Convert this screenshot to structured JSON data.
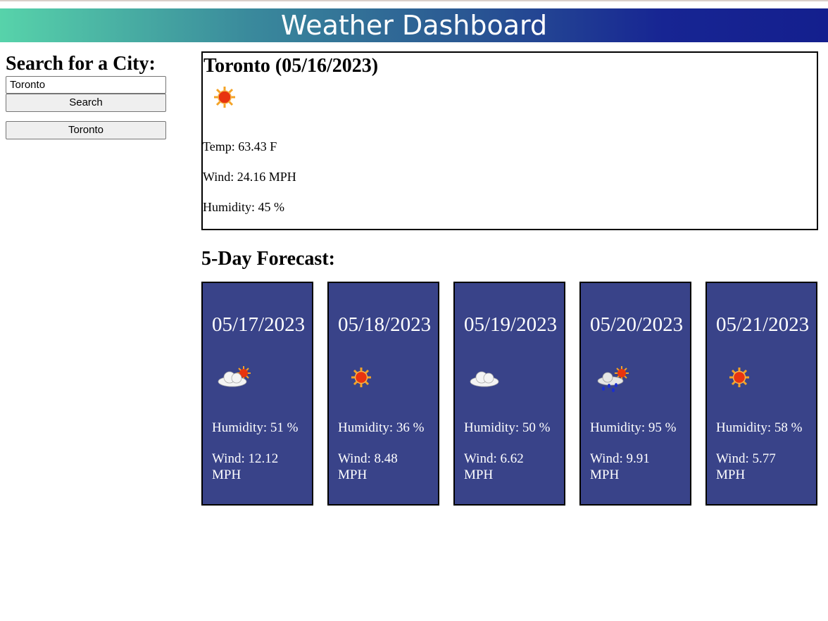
{
  "header": {
    "title": "Weather Dashboard"
  },
  "sidebar": {
    "heading": "Search for a City:",
    "search_value": "Toronto",
    "search_button": "Search",
    "history": [
      "Toronto"
    ]
  },
  "current": {
    "title": "Toronto (05/16/2023)",
    "icon": "sun-icon",
    "temp": "Temp: 63.43 F",
    "wind": "Wind: 24.16 MPH",
    "humidity": "Humidity: 45 %"
  },
  "forecast": {
    "heading": "5-Day Forecast:",
    "card_color": "#394389",
    "days": [
      {
        "date": "05/17/2023",
        "icon": "cloud-sun-icon",
        "humidity": "Humidity: 51 %",
        "wind": "Wind: 12.12 MPH"
      },
      {
        "date": "05/18/2023",
        "icon": "sun-icon",
        "humidity": "Humidity: 36 %",
        "wind": "Wind: 8.48 MPH"
      },
      {
        "date": "05/19/2023",
        "icon": "cloud-icon",
        "humidity": "Humidity: 50 %",
        "wind": "Wind: 6.62 MPH"
      },
      {
        "date": "05/20/2023",
        "icon": "rain-sun-icon",
        "humidity": "Humidity: 95 %",
        "wind": "Wind: 9.91 MPH"
      },
      {
        "date": "05/21/2023",
        "icon": "sun-icon",
        "humidity": "Humidity: 58 %",
        "wind": "Wind: 5.77 MPH"
      }
    ]
  }
}
